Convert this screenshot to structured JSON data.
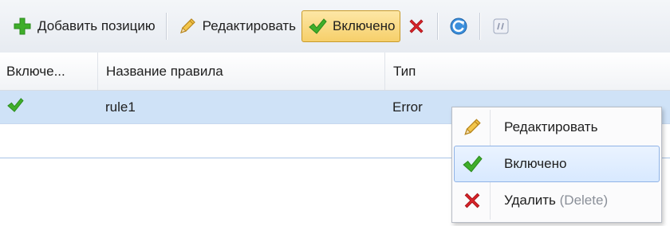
{
  "toolbar": {
    "add_label": "Добавить позицию",
    "edit_label": "Редактировать",
    "enabled_label": "Включено"
  },
  "grid": {
    "headers": [
      "Включе...",
      "Название правила",
      "Тип"
    ],
    "rows": [
      {
        "enabled": true,
        "name": "rule1",
        "type": "Error"
      }
    ]
  },
  "context_menu": {
    "items": [
      {
        "label": "Редактировать",
        "icon": "pencil-icon"
      },
      {
        "label": "Включено",
        "icon": "checkmark-icon"
      },
      {
        "label": "Удалить",
        "shortcut": "(Delete)",
        "icon": "delete-x-icon"
      }
    ]
  },
  "colors": {
    "accent_green": "#3fae2a",
    "delete_red": "#d8232a",
    "selection_blue": "#cfe2f7",
    "active_button": "#f6cf6a"
  }
}
